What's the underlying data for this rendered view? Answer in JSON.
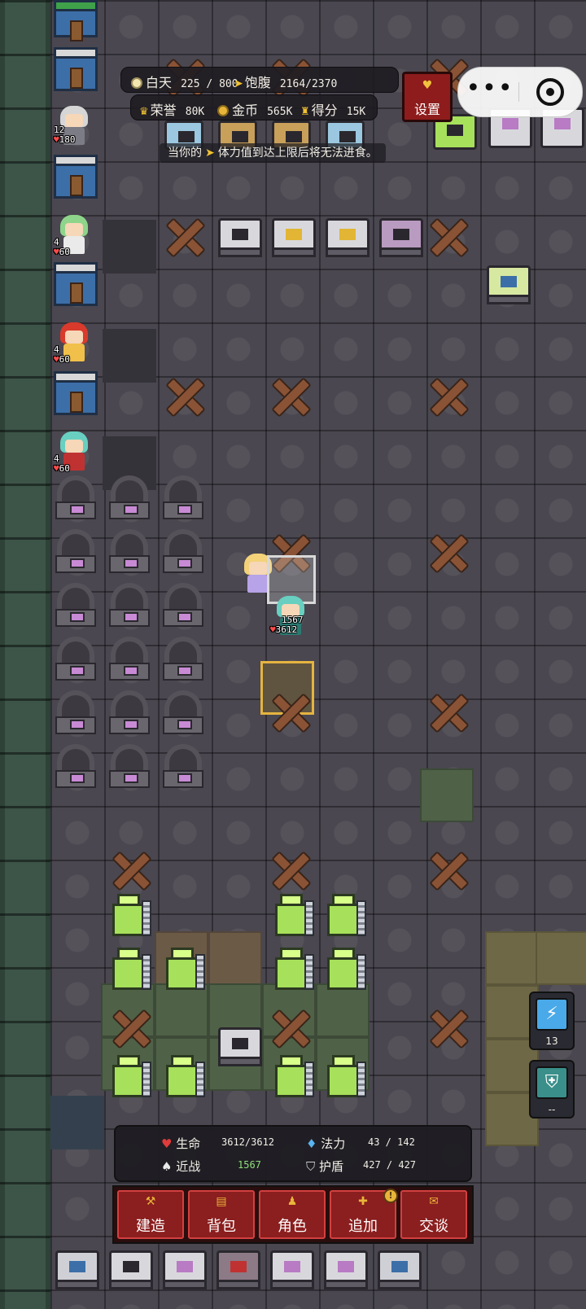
{
  "top_bar": {
    "day_label": "白天",
    "day_value": "225 / 800",
    "satiety_label": "饱腹",
    "satiety_value": "2164/2370",
    "honor_label": "荣誉",
    "honor_value": "80K",
    "gold_label": "金币",
    "gold_value": "565K",
    "score_label": "得分",
    "score_value": "15K",
    "settings_label": "设置"
  },
  "hint": {
    "prefix": "当你的",
    "suffix": "体力值到达上限后将无法进食。"
  },
  "party": [
    {
      "name": "party-member-elder",
      "atk": "12",
      "hp": "180",
      "hair": "#d6d6d6",
      "dress": "#7c7c86"
    },
    {
      "name": "party-member-green-twin",
      "atk": "4",
      "hp": "60",
      "hair": "#8ed48a",
      "dress": "#eaeaea"
    },
    {
      "name": "party-member-red-hood",
      "atk": "4",
      "hp": "60",
      "hair": "#d93a2c",
      "dress": "#f0c04a"
    },
    {
      "name": "party-member-teal",
      "atk": "4",
      "hp": "60",
      "hair": "#69cfc0",
      "dress": "#c03232"
    }
  ],
  "hero": {
    "atk": "1567",
    "hp": "3612"
  },
  "side_skills": [
    {
      "name": "lightning-skill",
      "icon": "⚡",
      "count": "13",
      "color": "#4aa9e8"
    },
    {
      "name": "shield-skill",
      "icon": "⛨",
      "count": "--",
      "color": "#3a8f8a"
    }
  ],
  "stats": {
    "hp_label": "生命",
    "hp_value": "3612/3612",
    "melee_label": "近战",
    "melee_value": "1567",
    "mana_label": "法力",
    "mana_value": "43 / 142",
    "shield_label": "护盾",
    "shield_value": "427 / 427"
  },
  "actions": [
    {
      "key": "build",
      "label": "建造",
      "icon": "⚒"
    },
    {
      "key": "bag",
      "label": "背包",
      "icon": "▤"
    },
    {
      "key": "role",
      "label": "角色",
      "icon": "♟"
    },
    {
      "key": "add",
      "label": "追加",
      "icon": "✚",
      "badge": "!"
    },
    {
      "key": "talk",
      "label": "交谈",
      "icon": "✉"
    }
  ],
  "colors": {
    "accent_red": "#8b1e1e",
    "gold": "#e8b53a",
    "selection": "#e5b440",
    "hp_red": "#ff4b4b"
  }
}
